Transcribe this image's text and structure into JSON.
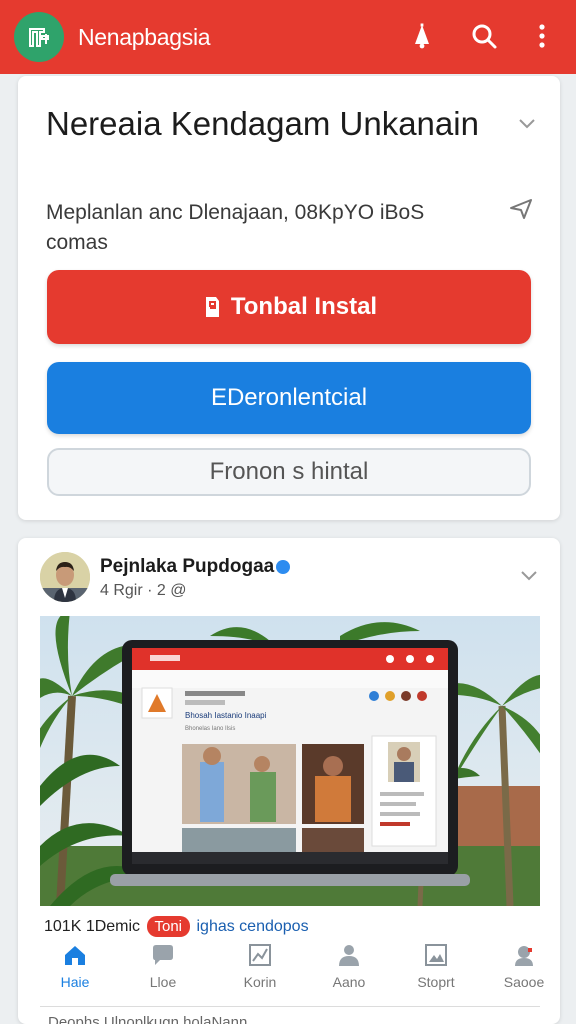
{
  "app": {
    "title": "Nenapbagsia",
    "colors": {
      "primary": "#e53a2f",
      "logo": "#2fa36b",
      "accent": "#1a7fe0"
    },
    "icons": [
      "app-logo-icon",
      "notification-bell-icon",
      "search-icon",
      "more-vert-icon"
    ]
  },
  "promo": {
    "title": "Nereaia Kendagam Unkanain",
    "subtitle": "Meplanlan anc Dlenajaan, 08KpYO iBoS comas",
    "primary_button": "Tonbal Instal",
    "secondary_button": "EDeronlentcial",
    "tertiary_button": "Fronon s hintal"
  },
  "post": {
    "author": "Pejnlaka Pupdogaa",
    "meta": "4 Rgir · 2 @",
    "caption_start": "101K 1Demic",
    "caption_tag": "Toni",
    "caption_end": "ighas cendopos",
    "image": {
      "dashboard_heading": "Bhosah Iastanio Inaapi",
      "dashboard_subheading": "Bhonelas Iano Ilsis"
    }
  },
  "tabs": [
    {
      "label": "Haie",
      "icon": "home-icon",
      "active": true
    },
    {
      "label": "Lloe",
      "icon": "chat-bubble-icon",
      "active": false
    },
    {
      "label": "Korin",
      "icon": "chart-icon",
      "active": false
    },
    {
      "label": "Aano",
      "icon": "person-icon",
      "active": false
    },
    {
      "label": "Stoprt",
      "icon": "image-icon",
      "active": false
    },
    {
      "label": "Saooe",
      "icon": "support-agent-icon",
      "active": false
    }
  ],
  "footer": {
    "text": "Deophs Ulnoplkugn holaNann"
  }
}
